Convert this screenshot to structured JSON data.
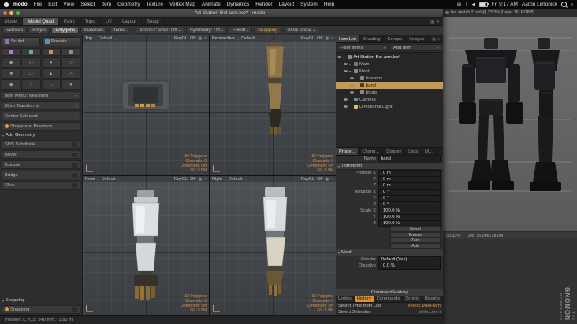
{
  "menubar": {
    "app_name": "modo",
    "menus": [
      "File",
      "Edit",
      "View",
      "Select",
      "Item",
      "Geometry",
      "Texture",
      "Vertex Map",
      "Animate",
      "Dynamics",
      "Render",
      "Layout",
      "System",
      "Help"
    ],
    "time": "Fri 9:17 AM",
    "user": "Aaron Limonick"
  },
  "modo": {
    "title": "Art Station Bot arm.lxo* - modo",
    "layout_tabs": [
      "Model",
      "Model Quad",
      "Paint",
      "Topo",
      "UV",
      "Layout",
      "Setup"
    ],
    "tool_row": {
      "modes": [
        "Vertices",
        "Edges",
        "Polygons",
        "Materials",
        "Items"
      ],
      "action_center": "Action Center: Off",
      "symmetry": "Symmetry: Off",
      "falloff": "Falloff",
      "snapping": "Snapping",
      "work_plane": "Work Plane"
    },
    "left_panel": {
      "sculpt": "Sculpt",
      "presets": "Presets",
      "item_menu": "Item Menu: New Item",
      "more_transforms": "More Transforms",
      "center_selected": "Center Selected",
      "shape_precision": "Shape and Precision",
      "add_geometry": "Add Geometry",
      "tools": [
        "SDS Subdivide",
        "Bevel",
        "Extrude",
        "Bridge",
        "Slice"
      ],
      "snapping_header": "Snapping",
      "snapping_row": "Snapping"
    },
    "viewports": {
      "views": [
        "Top",
        "Perspective",
        "Front",
        "Right"
      ],
      "shading": "Default",
      "raygl": "RayGL: Off",
      "stats": [
        "52 Polygons",
        "Channels: 0",
        "Deformers: Off",
        "GL: 5.9M"
      ]
    },
    "item_list": {
      "tabs": [
        "Item List",
        "Shading",
        "Groups",
        "Images"
      ],
      "filter": "Filter items",
      "add_item": "Add Item",
      "items": [
        {
          "label": "Art Station Bot arm.lxo*"
        },
        {
          "label": "Main"
        },
        {
          "label": "Mesh"
        },
        {
          "label": "forearm"
        },
        {
          "label": "hand"
        },
        {
          "label": "bicep"
        },
        {
          "label": "Camera"
        },
        {
          "label": "Directional Light"
        }
      ]
    },
    "properties": {
      "tabs": [
        "Prope...",
        "Chann...",
        "Display",
        "Lists",
        "M..."
      ],
      "name_label": "Name",
      "name_value": "hand",
      "transform_header": "Transform",
      "rows": [
        {
          "label": "Position X",
          "value": "0 m"
        },
        {
          "label": "Y",
          "value": "0 m"
        },
        {
          "label": "Z",
          "value": "0 m"
        },
        {
          "label": "Rotation X",
          "value": "0 °"
        },
        {
          "label": "Y",
          "value": "0 °"
        },
        {
          "label": "Z",
          "value": "0 °"
        },
        {
          "label": "Scale X",
          "value": "100.0 %"
        },
        {
          "label": "Y",
          "value": "100.0 %"
        },
        {
          "label": "Z",
          "value": "100.0 %"
        }
      ],
      "buttons": [
        "Reset",
        "Freeze",
        "Zero",
        "Add"
      ],
      "mesh_header": "Mesh",
      "mesh_rows": [
        {
          "label": "Render",
          "value": "Default (Yes)"
        },
        {
          "label": "Dissolve",
          "value": "0.0 %"
        }
      ]
    },
    "command_history": {
      "title": "Command History",
      "tabs": [
        "Undos",
        "History",
        "Commands",
        "Scripts",
        "Results"
      ],
      "rows": [
        {
          "label": "Select Type from List",
          "cmd": "select.typeFrom"
        },
        {
          "label": "Select Selection",
          "cmd": "select.item"
        }
      ]
    },
    "status_bar": "Position X, Y, Z:   340 mm,  -1.82 m"
  },
  "photoshop": {
    "title": "bot sketch 2.psd @ 33.3% (Layer 16, RGB/8)",
    "zoom": "33.33%",
    "doc": "Doc: 16.0M/178.0M"
  },
  "logo": {
    "the": "THE",
    "gnomon": "GNOMON",
    "workshop": "WORKSHOP"
  }
}
